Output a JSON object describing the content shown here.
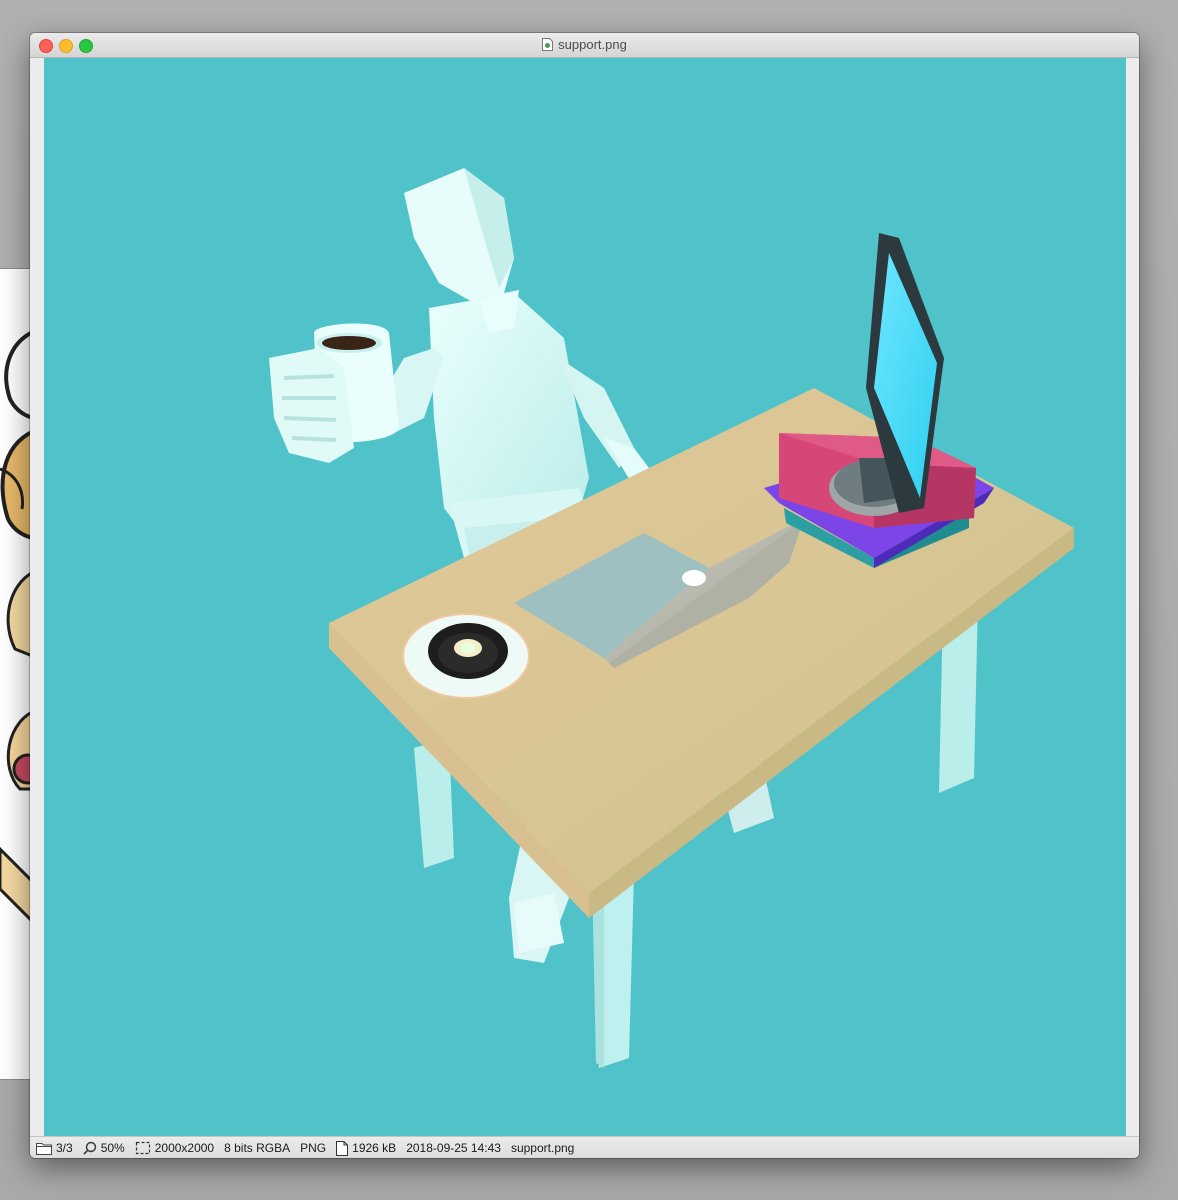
{
  "window": {
    "title": "support.png",
    "icons": {
      "title": "png-document-icon",
      "close": "close-icon",
      "minimize": "minimize-icon",
      "zoom": "zoom-icon"
    }
  },
  "image": {
    "background_color": "#4fc3c9",
    "subject_icons": [
      "mannequin",
      "coffee-mug",
      "desk",
      "laptop",
      "donut-plate",
      "monitor",
      "book-stack"
    ]
  },
  "statusbar": {
    "page_index": "3/3",
    "zoom": "50%",
    "dimensions": "2000x2000",
    "color_depth": "8 bits RGBA",
    "format": "PNG",
    "file_size": "1926 kB",
    "modified": "2018-09-25 14:43",
    "filename": "support.png",
    "icons": {
      "page": "folder-icon",
      "zoom": "magnifier-icon",
      "dimensions": "selection-icon",
      "file": "file-icon"
    }
  }
}
